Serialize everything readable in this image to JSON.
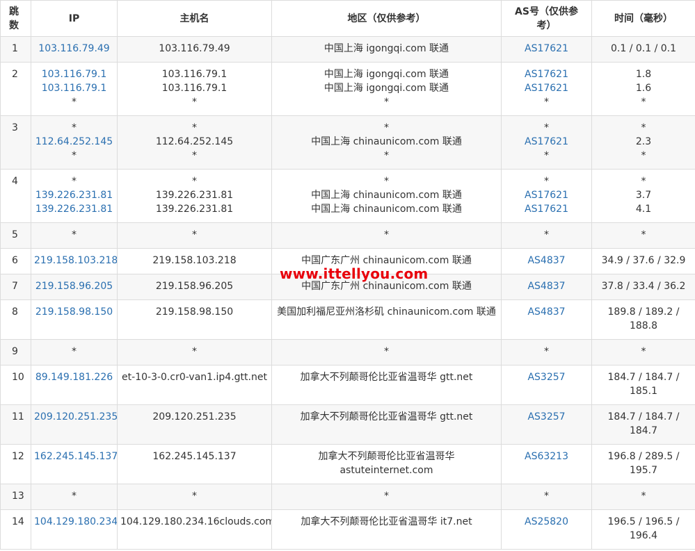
{
  "headers": {
    "hop": "跳数",
    "ip": "IP",
    "host": "主机名",
    "region": "地区（仅供参考）",
    "asn": "AS号（仅供参考）",
    "time": "时间（毫秒）"
  },
  "rows": [
    {
      "hop": "1",
      "ip": [
        "103.116.79.49"
      ],
      "host": [
        "103.116.79.49"
      ],
      "region": [
        "中国上海 igongqi.com 联通"
      ],
      "asn": [
        "AS17621"
      ],
      "time": [
        "0.1 / 0.1 / 0.1"
      ]
    },
    {
      "hop": "2",
      "ip": [
        "103.116.79.1",
        "103.116.79.1",
        "*"
      ],
      "host": [
        "103.116.79.1",
        "103.116.79.1",
        "*"
      ],
      "region": [
        "中国上海 igongqi.com 联通",
        "中国上海 igongqi.com 联通",
        "*"
      ],
      "asn": [
        "AS17621",
        "AS17621",
        "*"
      ],
      "time": [
        "1.8",
        "1.6",
        "*"
      ]
    },
    {
      "hop": "3",
      "ip": [
        "*",
        "112.64.252.145",
        "*"
      ],
      "host": [
        "*",
        "112.64.252.145",
        "*"
      ],
      "region": [
        "*",
        "中国上海 chinaunicom.com 联通",
        "*"
      ],
      "asn": [
        "*",
        "AS17621",
        "*"
      ],
      "time": [
        "*",
        "2.3",
        "*"
      ]
    },
    {
      "hop": "4",
      "ip": [
        "*",
        "139.226.231.81",
        "139.226.231.81"
      ],
      "host": [
        "*",
        "139.226.231.81",
        "139.226.231.81"
      ],
      "region": [
        "*",
        "中国上海 chinaunicom.com 联通",
        "中国上海 chinaunicom.com 联通"
      ],
      "asn": [
        "*",
        "AS17621",
        "AS17621"
      ],
      "time": [
        "*",
        "3.7",
        "4.1"
      ]
    },
    {
      "hop": "5",
      "ip": [
        "*"
      ],
      "host": [
        "*"
      ],
      "region": [
        "*"
      ],
      "asn": [
        "*"
      ],
      "time": [
        "*"
      ]
    },
    {
      "hop": "6",
      "ip": [
        "219.158.103.218"
      ],
      "host": [
        "219.158.103.218"
      ],
      "region": [
        "中国广东广州 chinaunicom.com 联通"
      ],
      "asn": [
        "AS4837"
      ],
      "time": [
        "34.9 / 37.6 / 32.9"
      ]
    },
    {
      "hop": "7",
      "ip": [
        "219.158.96.205"
      ],
      "host": [
        "219.158.96.205"
      ],
      "region": [
        "中国广东广州 chinaunicom.com 联通"
      ],
      "asn": [
        "AS4837"
      ],
      "time": [
        "37.8 / 33.4 / 36.2"
      ]
    },
    {
      "hop": "8",
      "ip": [
        "219.158.98.150"
      ],
      "host": [
        "219.158.98.150"
      ],
      "region": [
        "美国加利福尼亚州洛杉矶 chinaunicom.com 联通"
      ],
      "asn": [
        "AS4837"
      ],
      "time": [
        "189.8 / 189.2 /",
        "188.8"
      ]
    },
    {
      "hop": "9",
      "ip": [
        "*"
      ],
      "host": [
        "*"
      ],
      "region": [
        "*"
      ],
      "asn": [
        "*"
      ],
      "time": [
        "*"
      ]
    },
    {
      "hop": "10",
      "ip": [
        "89.149.181.226"
      ],
      "host": [
        "et-10-3-0.cr0-van1.ip4.gtt.net"
      ],
      "region": [
        "加拿大不列颠哥伦比亚省温哥华 gtt.net"
      ],
      "asn": [
        "AS3257"
      ],
      "time": [
        "184.7 / 184.7 /",
        "185.1"
      ]
    },
    {
      "hop": "11",
      "ip": [
        "209.120.251.235"
      ],
      "host": [
        "209.120.251.235"
      ],
      "region": [
        "加拿大不列颠哥伦比亚省温哥华 gtt.net"
      ],
      "asn": [
        "AS3257"
      ],
      "time": [
        "184.7 / 184.7 /",
        "184.7"
      ]
    },
    {
      "hop": "12",
      "ip": [
        "162.245.145.137"
      ],
      "host": [
        "162.245.145.137"
      ],
      "region": [
        "加拿大不列颠哥伦比亚省温哥华",
        "astuteinternet.com"
      ],
      "asn": [
        "AS63213"
      ],
      "time": [
        "196.8 / 289.5 /",
        "195.7"
      ]
    },
    {
      "hop": "13",
      "ip": [
        "*"
      ],
      "host": [
        "*"
      ],
      "region": [
        "*"
      ],
      "asn": [
        "*"
      ],
      "time": [
        "*"
      ]
    },
    {
      "hop": "14",
      "ip": [
        "104.129.180.234"
      ],
      "host": [
        "104.129.180.234.16clouds.com"
      ],
      "region": [
        "加拿大不列颠哥伦比亚省温哥华 it7.net"
      ],
      "asn": [
        "AS25820"
      ],
      "time": [
        "196.5 / 196.5 /",
        "196.4"
      ]
    }
  ],
  "watermark": "www.ittellyou.com"
}
